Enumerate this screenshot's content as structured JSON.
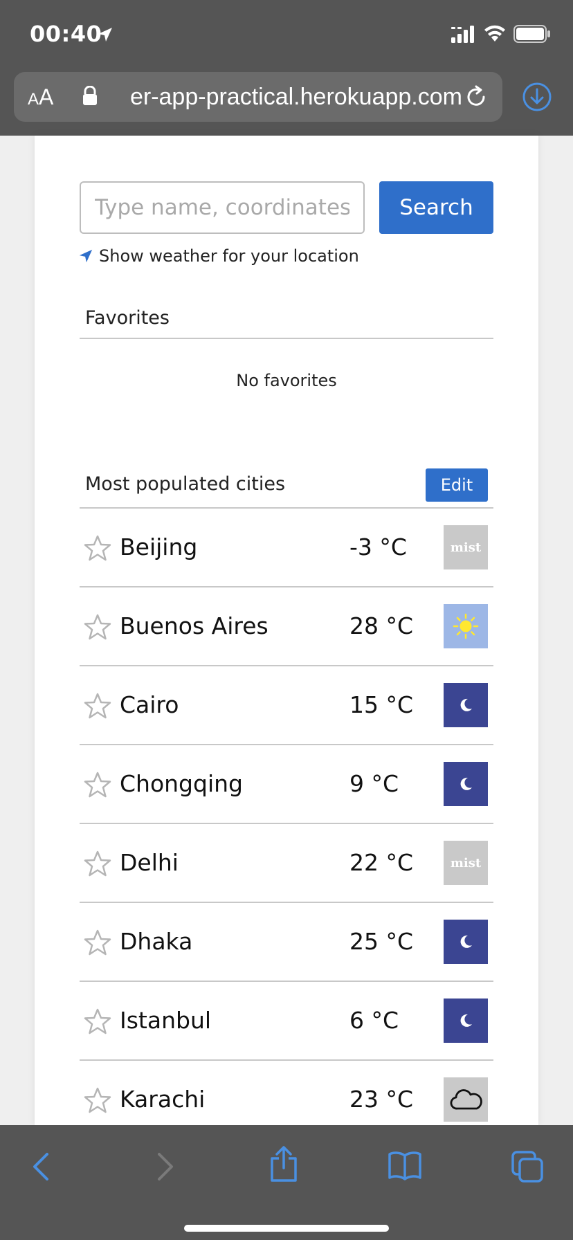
{
  "status_bar": {
    "time": "00:40",
    "icons": [
      "location-arrow-icon",
      "signal-icon",
      "wifi-icon",
      "battery-icon"
    ]
  },
  "browser": {
    "text_size_small": "A",
    "text_size_big": "A",
    "url": "er-app-practical.herokuapp.com",
    "icons": [
      "lock-icon",
      "reload-icon",
      "download-icon"
    ],
    "toolbar_icons": [
      "back-icon",
      "forward-icon",
      "share-icon",
      "bookmarks-icon",
      "tabs-icon"
    ]
  },
  "search": {
    "placeholder": "Type name, coordinates or zip",
    "button_label": "Search",
    "location_link": "Show weather for your location"
  },
  "favorites": {
    "title": "Favorites",
    "empty_text": "No favorites"
  },
  "populated": {
    "title": "Most populated cities",
    "edit_label": "Edit",
    "cities": [
      {
        "name": "Beijing",
        "temp": "-3 °C",
        "condition": "mist",
        "icon_label": "mist"
      },
      {
        "name": "Buenos Aires",
        "temp": "28 °C",
        "condition": "clear-day",
        "icon_label": ""
      },
      {
        "name": "Cairo",
        "temp": "15 °C",
        "condition": "clear-night",
        "icon_label": ""
      },
      {
        "name": "Chongqing",
        "temp": "9 °C",
        "condition": "clear-night",
        "icon_label": ""
      },
      {
        "name": "Delhi",
        "temp": "22 °C",
        "condition": "mist",
        "icon_label": "mist"
      },
      {
        "name": "Dhaka",
        "temp": "25 °C",
        "condition": "clear-night",
        "icon_label": ""
      },
      {
        "name": "Istanbul",
        "temp": "6 °C",
        "condition": "clear-night",
        "icon_label": ""
      },
      {
        "name": "Karachi",
        "temp": "23 °C",
        "condition": "clouds",
        "icon_label": ""
      }
    ]
  },
  "colors": {
    "accent": "#2f6fca",
    "chrome": "#555555",
    "ios_blue": "#4a90e2"
  }
}
